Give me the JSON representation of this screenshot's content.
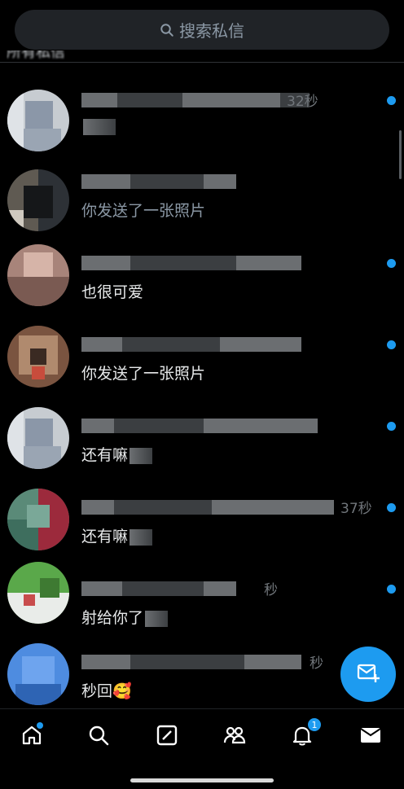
{
  "search": {
    "placeholder": "搜索私信"
  },
  "section": {
    "title": "所有私信"
  },
  "conversations": [
    {
      "time": "32秒",
      "preview": "",
      "sent": false,
      "unread": true
    },
    {
      "time": "",
      "preview": "你发送了一张照片",
      "sent": true,
      "unread": false
    },
    {
      "time": "",
      "preview": "也很可爱",
      "sent": false,
      "unread": true
    },
    {
      "time": "",
      "preview": "你发送了一张照片",
      "sent": false,
      "unread": true
    },
    {
      "time": "",
      "preview": "还有嘛",
      "sent": false,
      "unread": true
    },
    {
      "time": "37秒",
      "preview": "还有嘛",
      "sent": false,
      "unread": true
    },
    {
      "time": "秒",
      "preview": "射给你了",
      "sent": false,
      "unread": true
    },
    {
      "time": "秒",
      "preview": "秒回🥰",
      "sent": false,
      "unread": false
    }
  ],
  "tabbar": {
    "tabs": [
      "home-icon",
      "search-icon",
      "grok-icon",
      "communities-icon",
      "bell-icon",
      "mail-icon"
    ],
    "notification_count": "1"
  },
  "colors": {
    "accent": "#1d9bf0",
    "background": "#000000",
    "search_bg": "#202327"
  }
}
